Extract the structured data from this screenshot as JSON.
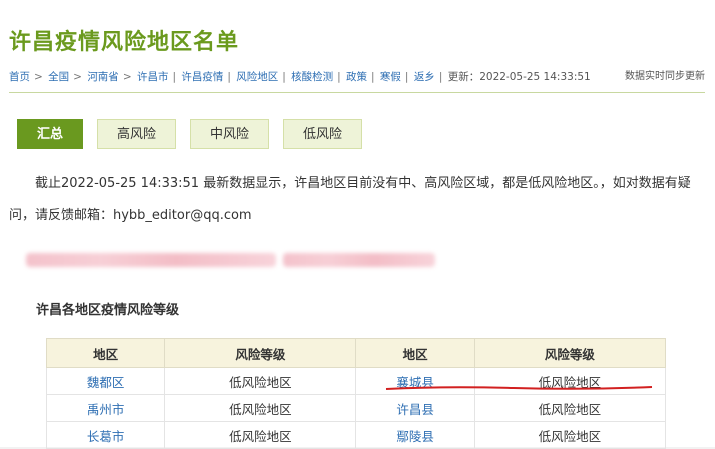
{
  "page": {
    "title": "许昌疫情风险地区名单",
    "breadcrumb": [
      "首页",
      "全国",
      "河南省",
      "许昌市",
      "许昌疫情",
      "风险地区",
      "核酸检测",
      "政策",
      "寒假",
      "返乡"
    ],
    "updated": "更新：2022-05-25 14:33:51",
    "sync_note": "数据实时同步更新"
  },
  "tabs": [
    {
      "label": "汇总"
    },
    {
      "label": "高风险"
    },
    {
      "label": "中风险"
    },
    {
      "label": "低风险"
    }
  ],
  "notice": "截止2022-05-25 14:33:51 最新数据显示，许昌地区目前没有中、高风险区域，都是低风险地区。，如对数据有疑问，请反馈邮箱：hybb_editor@qq.com",
  "section_title": "许昌各地区疫情风险等级",
  "table": {
    "headers": [
      "地区",
      "风险等级",
      "地区",
      "风险等级"
    ],
    "rows": [
      [
        "魏都区",
        "低风险地区",
        "襄城县",
        "低风险地区"
      ],
      [
        "禹州市",
        "低风险地区",
        "许昌县",
        "低风险地区"
      ],
      [
        "长葛市",
        "低风险地区",
        "鄢陵县",
        "低风险地区"
      ]
    ]
  }
}
